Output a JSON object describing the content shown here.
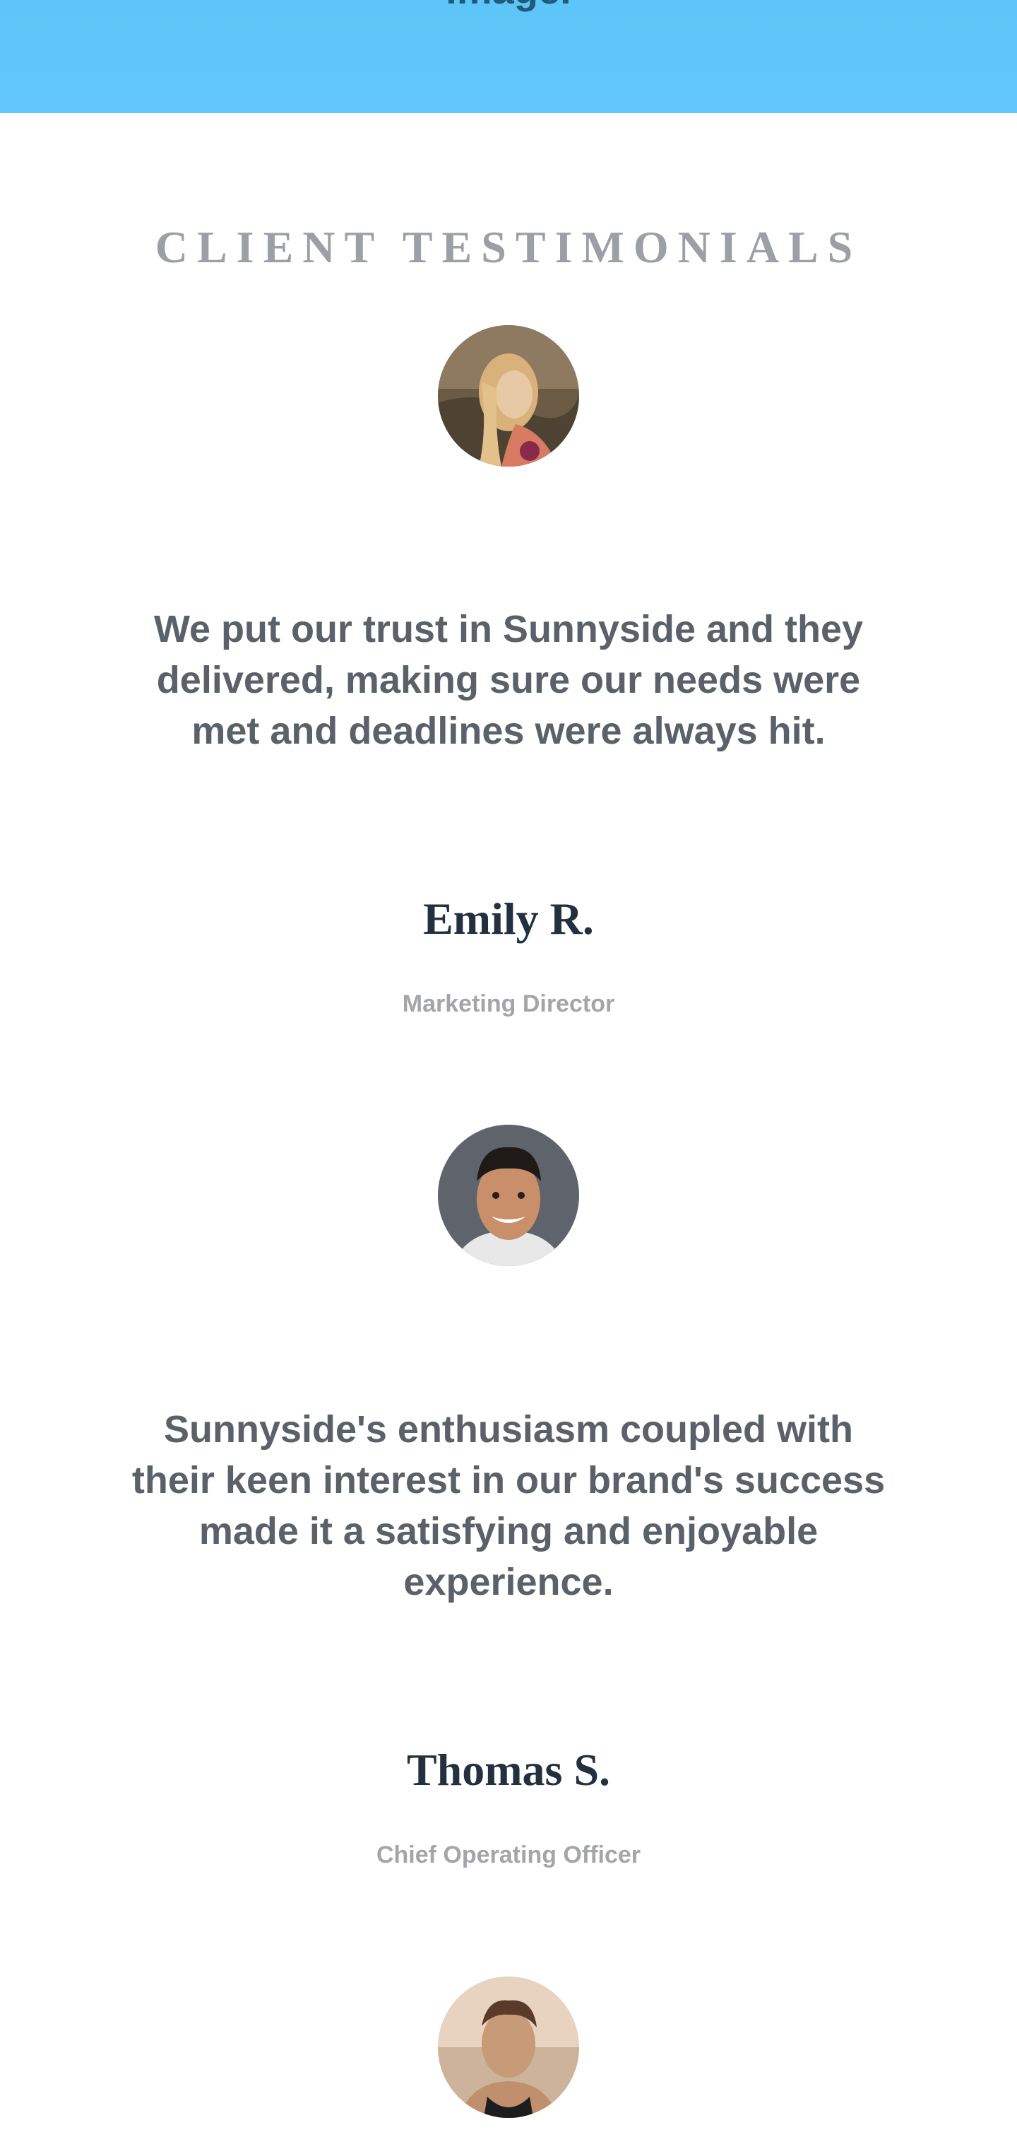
{
  "hero": {
    "caption": "image."
  },
  "testimonials": {
    "title": "CLIENT TESTIMONIALS",
    "items": [
      {
        "quote": "We put our trust in Sunnyside and they delivered, making sure our needs were met and deadlines were always hit.",
        "name": "Emily R.",
        "role": "Marketing Director",
        "avatar_icon": "woman-portrait-icon"
      },
      {
        "quote": "Sunnyside's enthusiasm coupled with their keen interest in our brand's success made it a satisfying and enjoyable experience.",
        "name": "Thomas S.",
        "role": "Chief Operating Officer",
        "avatar_icon": "man-portrait-icon"
      },
      {
        "avatar_icon": "woman-portrait-icon"
      }
    ]
  },
  "colors": {
    "hero_blue": "#62c7fd",
    "title_gray": "#9ca0a6",
    "quote_gray": "#5b6169",
    "name_navy": "#23303f",
    "role_gray": "#a3a5a9"
  }
}
